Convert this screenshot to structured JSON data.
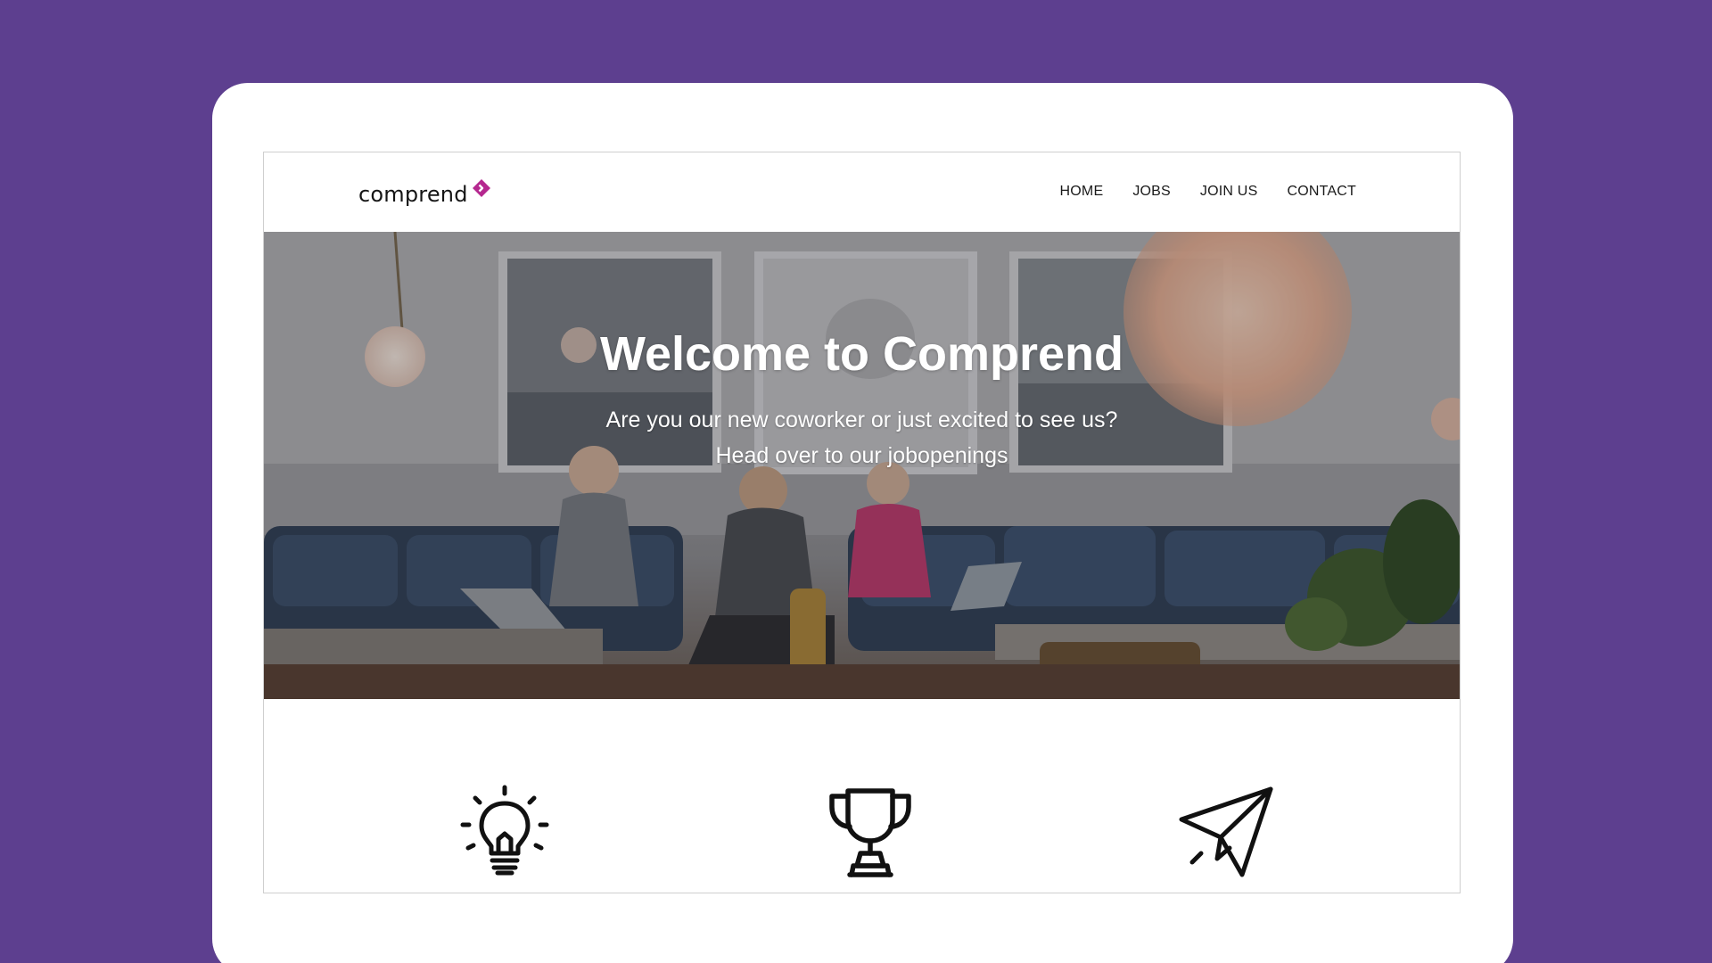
{
  "brand": {
    "name": "comprend",
    "accent": "#b5288f",
    "background": "#5d3f8f"
  },
  "nav": {
    "items": [
      {
        "label": "HOME"
      },
      {
        "label": "JOBS"
      },
      {
        "label": "JOIN US"
      },
      {
        "label": "CONTACT"
      }
    ]
  },
  "hero": {
    "title": "Welcome to Comprend",
    "line1": "Are you our new coworker or just excited to see us?",
    "line2": "Head over to our jobopenings"
  },
  "features": {
    "icons": [
      "lightbulb-icon",
      "trophy-icon",
      "paper-plane-icon"
    ]
  }
}
